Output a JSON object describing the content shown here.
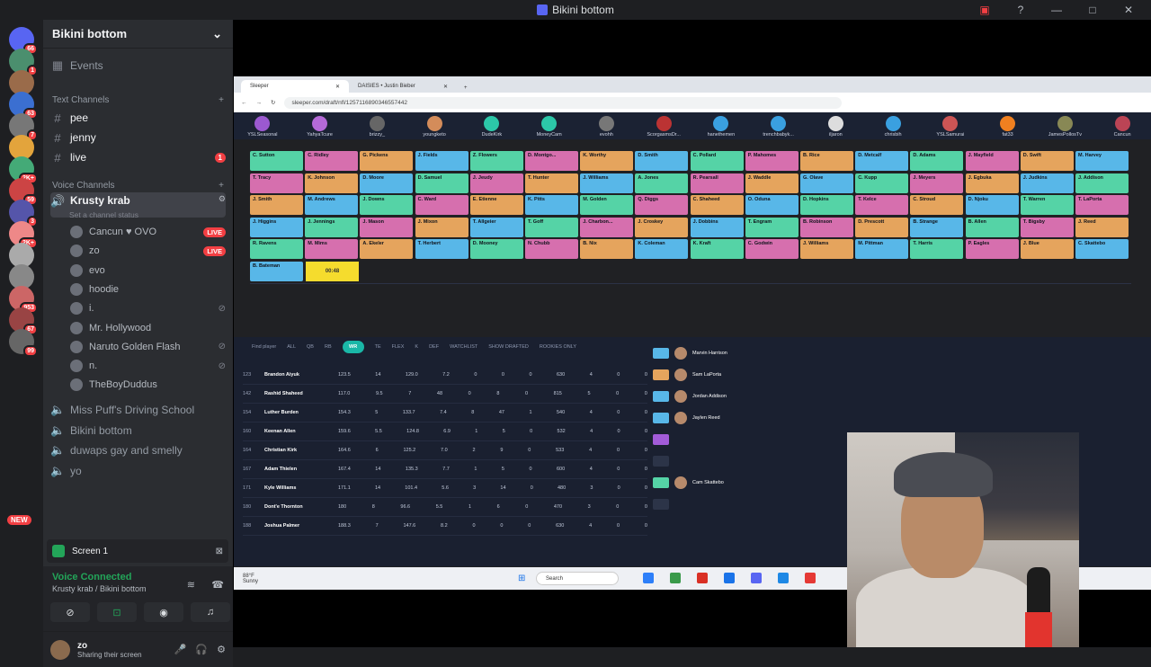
{
  "window": {
    "title": "Bikini bottom"
  },
  "server_rail": {
    "badges": [
      "66",
      "1",
      "",
      "63",
      "7",
      "",
      "2K+",
      "59",
      "3",
      "2K+",
      "",
      "",
      "953",
      "67",
      "99"
    ],
    "new_label": "NEW"
  },
  "guild": {
    "name": "Bikini bottom"
  },
  "channels": {
    "events": "Events",
    "text_category": "Text Channels",
    "text": [
      {
        "name": "pee"
      },
      {
        "name": "jenny"
      },
      {
        "name": "live",
        "badge": "1"
      }
    ],
    "voice_category": "Voice Channels",
    "active_voice": {
      "name": "Krusty krab",
      "status": "Set a channel status"
    },
    "voice_users": [
      {
        "name": "Cancun ♥ OVO",
        "live": "LIVE"
      },
      {
        "name": "zo",
        "live": "LIVE"
      },
      {
        "name": "evo"
      },
      {
        "name": "hoodie"
      },
      {
        "name": "i."
      },
      {
        "name": "Mr. Hollywood"
      },
      {
        "name": "Naruto Golden Flash"
      },
      {
        "name": "n."
      },
      {
        "name": "TheBoyDuddus"
      }
    ],
    "other_voice": [
      "Miss Puff's Driving School",
      "Bikini bottom",
      "duwaps gay and smelly",
      "yo"
    ]
  },
  "screen_panel": {
    "label": "Screen 1"
  },
  "voice_connected": {
    "title": "Voice Connected",
    "location": "Krusty krab / Bikini bottom"
  },
  "user": {
    "name": "zo",
    "status": "Sharing their screen"
  },
  "browser": {
    "tabs": [
      "Sleeper",
      "DAISIES • Justin Bieber"
    ],
    "url": "sleeper.com/draft/nfl/1257116890346557442",
    "teams": [
      "YSLSeasonal",
      "YahyaTcure",
      "brizzy_",
      "youngketo",
      "DudeKirk",
      "MoneyCam",
      "evohh",
      "ScorgasmsDr...",
      "hanethemen",
      "trenchbabyk...",
      "iljaron",
      "chrisbih",
      "YSLSamurai",
      "fat33",
      "JamesPollosTv",
      "Cancun"
    ],
    "team_colors": [
      "#9b59d0",
      "#b56ad8",
      "#666",
      "#d48c5a",
      "#2cc7a8",
      "#2cc7a8",
      "#777",
      "#b33",
      "#3aa0e0",
      "#3aa0e0",
      "#ddd",
      "#3aa0e0",
      "#c55",
      "#f08020",
      "#885",
      "#b45"
    ],
    "board_rows": [
      [
        "C. Sutton",
        "C. Ridley",
        "G. Pickens",
        "J. Fields",
        "Z. Flowers",
        "D. Montgo...",
        "K. Worthy",
        "D. Smith",
        "C. Pollard",
        "P. Mahomes",
        "B. Rice",
        "D. Metcalf",
        "D. Adams",
        "J. Mayfield",
        "D. Swift",
        "M. Harvey"
      ],
      [
        "T. Tracy",
        "K. Johnson",
        "D. Moore",
        "D. Samuel",
        "J. Jeudy",
        "T. Hunter",
        "J. Williams",
        "A. Jones",
        "R. Pearsall",
        "J. Waddle",
        "G. Olave",
        "C. Kupp",
        "J. Meyers",
        "J. Egbuka",
        "J. Judkins",
        "J. Addison"
      ],
      [
        "J. Smith",
        "M. Andrews",
        "J. Downs",
        "C. Ward",
        "E. Etienne",
        "K. Pitts",
        "M. Golden",
        "Q. Diggs",
        "C. Shaheed",
        "O. Oduna",
        "D. Hopkins",
        "T. Kelce",
        "C. Stroud",
        "D. Njoku",
        "T. Warren",
        "T. LaPorta"
      ],
      [
        "J. Higgins",
        "J. Jennings",
        "J. Mason",
        "J. Mixon",
        "T. Allgeier",
        "T. Goff",
        "J. Charbon...",
        "J. Croskey",
        "J. Dobbins",
        "T. Engram",
        "B. Robinson",
        "D. Prescott",
        "B. Strange",
        "B. Allen",
        "T. Bigsby",
        "J. Reed"
      ],
      [
        "R. Ravens",
        "M. Mims",
        "A. Ekeler",
        "T. Herbert",
        "D. Mooney",
        "N. Chubb",
        "B. Nix",
        "K. Coleman",
        "K. Kraft",
        "C. Godwin",
        "J. Williams",
        "M. Pittman",
        "T. Harris",
        "P. Eagles",
        "J. Blue",
        "C. Skattebo"
      ]
    ],
    "pick_17": "B. Bateman",
    "timer": "00:48",
    "filters": [
      "Find player",
      "ALL",
      "QB",
      "RB",
      "WR",
      "TE",
      "FLEX",
      "K",
      "DEF",
      "WATCHLIST",
      "SHOW DRAFTED",
      "ROOKIES ONLY"
    ],
    "players": [
      {
        "rank": "123",
        "name": "Brandon Aiyuk",
        "vals": [
          "123.5",
          "14",
          "129.0",
          "7.2",
          "0",
          "0",
          "0",
          "630",
          "4",
          "0",
          "0"
        ]
      },
      {
        "rank": "142",
        "name": "Rashid Shaheed",
        "vals": [
          "117.0",
          "9.5",
          "7",
          "48",
          "0",
          "8",
          "0",
          "815",
          "5",
          "0",
          "0"
        ]
      },
      {
        "rank": "154",
        "name": "Luther Burden",
        "vals": [
          "154.3",
          "5",
          "133.7",
          "7.4",
          "8",
          "47",
          "1",
          "540",
          "4",
          "0",
          "0"
        ]
      },
      {
        "rank": "160",
        "name": "Keenan Allen",
        "vals": [
          "159.6",
          "5.5",
          "124.8",
          "6.9",
          "1",
          "5",
          "0",
          "532",
          "4",
          "0",
          "0"
        ]
      },
      {
        "rank": "164",
        "name": "Christian Kirk",
        "vals": [
          "164.6",
          "6",
          "125.2",
          "7.0",
          "2",
          "9",
          "0",
          "533",
          "4",
          "0",
          "0"
        ]
      },
      {
        "rank": "167",
        "name": "Adam Thielen",
        "vals": [
          "167.4",
          "14",
          "135.3",
          "7.7",
          "1",
          "5",
          "0",
          "600",
          "4",
          "0",
          "0"
        ]
      },
      {
        "rank": "171",
        "name": "Kyle Williams",
        "vals": [
          "171.1",
          "14",
          "101.4",
          "5.6",
          "3",
          "14",
          "0",
          "480",
          "3",
          "0",
          "0"
        ]
      },
      {
        "rank": "180",
        "name": "Dont'e Thornton",
        "vals": [
          "180",
          "8",
          "96.6",
          "5.5",
          "1",
          "6",
          "0",
          "470",
          "3",
          "0",
          "0"
        ]
      },
      {
        "rank": "188",
        "name": "Joshua Palmer",
        "vals": [
          "188.3",
          "7",
          "147.6",
          "8.2",
          "0",
          "0",
          "0",
          "630",
          "4",
          "0",
          "0"
        ]
      }
    ],
    "roster": [
      "Marvin Harrison",
      "Sam LaPorta",
      "Jordan Addison",
      "Jaylen Reed",
      "",
      "",
      "Cam Skattebo",
      ""
    ],
    "taskbar": {
      "weather": "88°F",
      "weather_sub": "Sunny",
      "search": "Search"
    }
  }
}
